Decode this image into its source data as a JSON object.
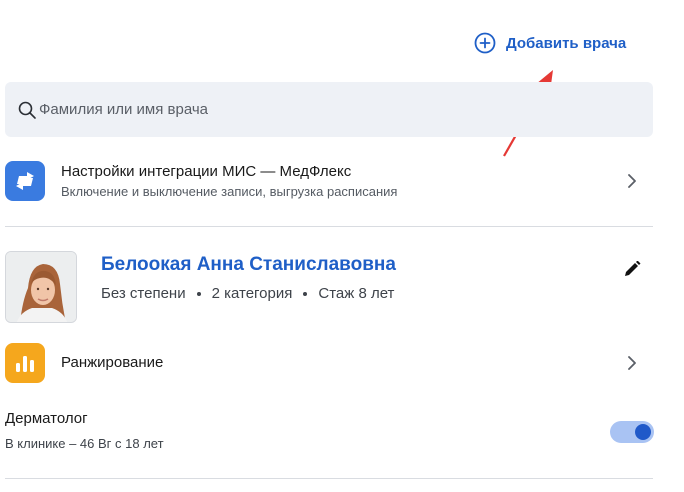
{
  "header": {
    "add_doctor_label": "Добавить врача",
    "add_icon": "plus-circle-icon"
  },
  "search": {
    "placeholder": "Фамилия или имя врача",
    "icon": "search-icon"
  },
  "integration": {
    "title": "Настройки интеграции МИС — МедФлекс",
    "subtitle": "Включение и выключение записи, выгрузка расписания",
    "icon": "sync-arrows-icon",
    "icon_color": "#3a7be0"
  },
  "doctor": {
    "name": "Белоокая Анна Станиславовна",
    "degree": "Без степени",
    "category": "2 категория",
    "experience": "Стаж 8 лет",
    "name_color": "#1f5fc7"
  },
  "ranking": {
    "label": "Ранжирование",
    "icon": "bar-chart-icon",
    "icon_color": "#f5a71d"
  },
  "specialty": {
    "title": "Дерматолог",
    "subtitle": "В клинике – 46 Вг с 18 лет",
    "toggle_on": true
  },
  "colors": {
    "accent": "#1f5fc7",
    "arrow": "#e53935"
  }
}
